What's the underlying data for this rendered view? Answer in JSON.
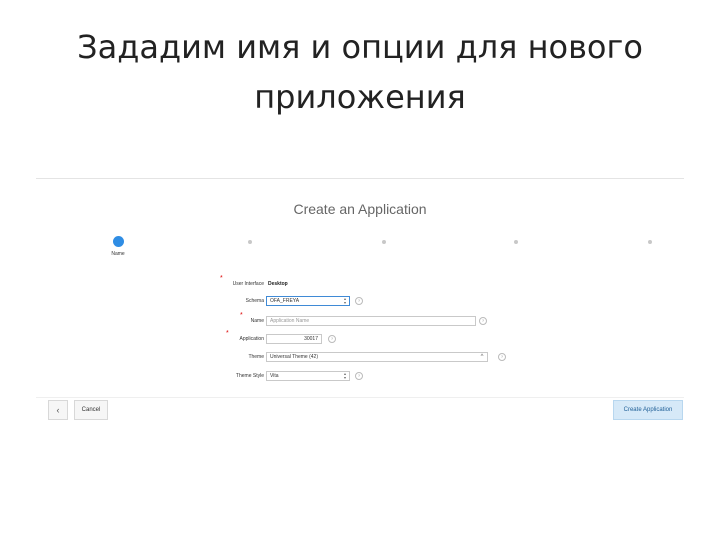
{
  "slide": {
    "title_line1": "Зададим имя и опции для нового",
    "title_line2": "приложения"
  },
  "wizard": {
    "title": "Create an Application",
    "steps": [
      {
        "label": "Name",
        "active": true
      },
      {
        "label": "",
        "active": false
      },
      {
        "label": "",
        "active": false
      },
      {
        "label": "",
        "active": false
      },
      {
        "label": "",
        "active": false
      }
    ]
  },
  "form": {
    "user_interface": {
      "label": "User Interface",
      "value": "Desktop"
    },
    "schema": {
      "label": "Schema",
      "value": "OFA_FREYA"
    },
    "name": {
      "label": "Name",
      "placeholder": "Application Name"
    },
    "application": {
      "label": "Application",
      "value": "30017"
    },
    "theme": {
      "label": "Theme",
      "value": "Universal Theme (42)"
    },
    "theme_style": {
      "label": "Theme Style",
      "value": "Vita"
    }
  },
  "footer": {
    "back_symbol": "‹",
    "cancel_label": "Cancel",
    "create_label": "Create Application"
  },
  "colors": {
    "active_step": "#2f8de4",
    "required_marker": "#dd0000",
    "primary_button_bg": "#d6e9f8"
  }
}
